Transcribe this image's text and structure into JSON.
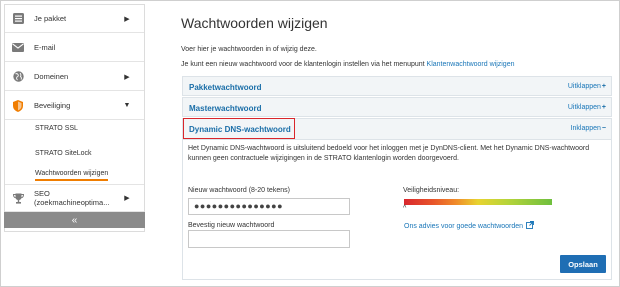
{
  "sidebar": {
    "items": [
      {
        "label": "Je pakket",
        "icon": "settings-list-icon",
        "caret": "▶"
      },
      {
        "label": "E-mail",
        "icon": "envelope-icon",
        "caret": ""
      },
      {
        "label": "Domeinen",
        "icon": "globe-icon",
        "caret": "▶"
      },
      {
        "label": "Beveiliging",
        "icon": "shield-icon",
        "caret": "▼"
      },
      {
        "label": "SEO (zoekmachineoptima...",
        "icon": "trophy-icon",
        "caret": "▶"
      }
    ],
    "sub_items": [
      "STRATO SSL",
      "STRATO SiteLock",
      "Wachtwoorden wijzigen"
    ],
    "collapse_label": "«"
  },
  "main": {
    "title": "Wachtwoorden wijzigen",
    "intro": "Voer hier je wachtwoorden in of wijzig deze.",
    "intro2_text": "Je kunt een nieuw wachtwoord voor de klantenlogin instellen via het menupunt ",
    "intro2_link": "Klantenwachtwoord wijzigen",
    "accordions": [
      {
        "title": "Pakketwachtwoord",
        "toggle": "Uitklappen",
        "sign": "+"
      },
      {
        "title": "Masterwachtwoord",
        "toggle": "Uitklappen",
        "sign": "+"
      },
      {
        "title": "Dynamic DNS-wachtwoord",
        "toggle": "Inklappen",
        "sign": "−"
      }
    ],
    "panel": {
      "description": "Het Dynamic DNS-wachtwoord is uitsluitend bedoeld voor het inloggen met je DynDNS-client. Met het Dynamic DNS-wachtwoord kunnen geen contractuele wijzigingen in de STRATO klantenlogin worden doorgevoerd.",
      "new_label": "Nieuw wachtwoord (8-20 tekens)",
      "new_value": "●●●●●●●●●●●●●●●",
      "confirm_label": "Bevestig nieuw wachtwoord",
      "confirm_value": "",
      "level_label": "Veiligheidsniveau:",
      "level_marker": "^",
      "advice_link": "Ons advies voor goede wachtwoorden",
      "save_label": "Opslaan"
    }
  },
  "colors": {
    "accent": "#1f6eb4",
    "link": "#1976b8",
    "highlight": "#d9262b",
    "active_underline": "#f07d00"
  }
}
